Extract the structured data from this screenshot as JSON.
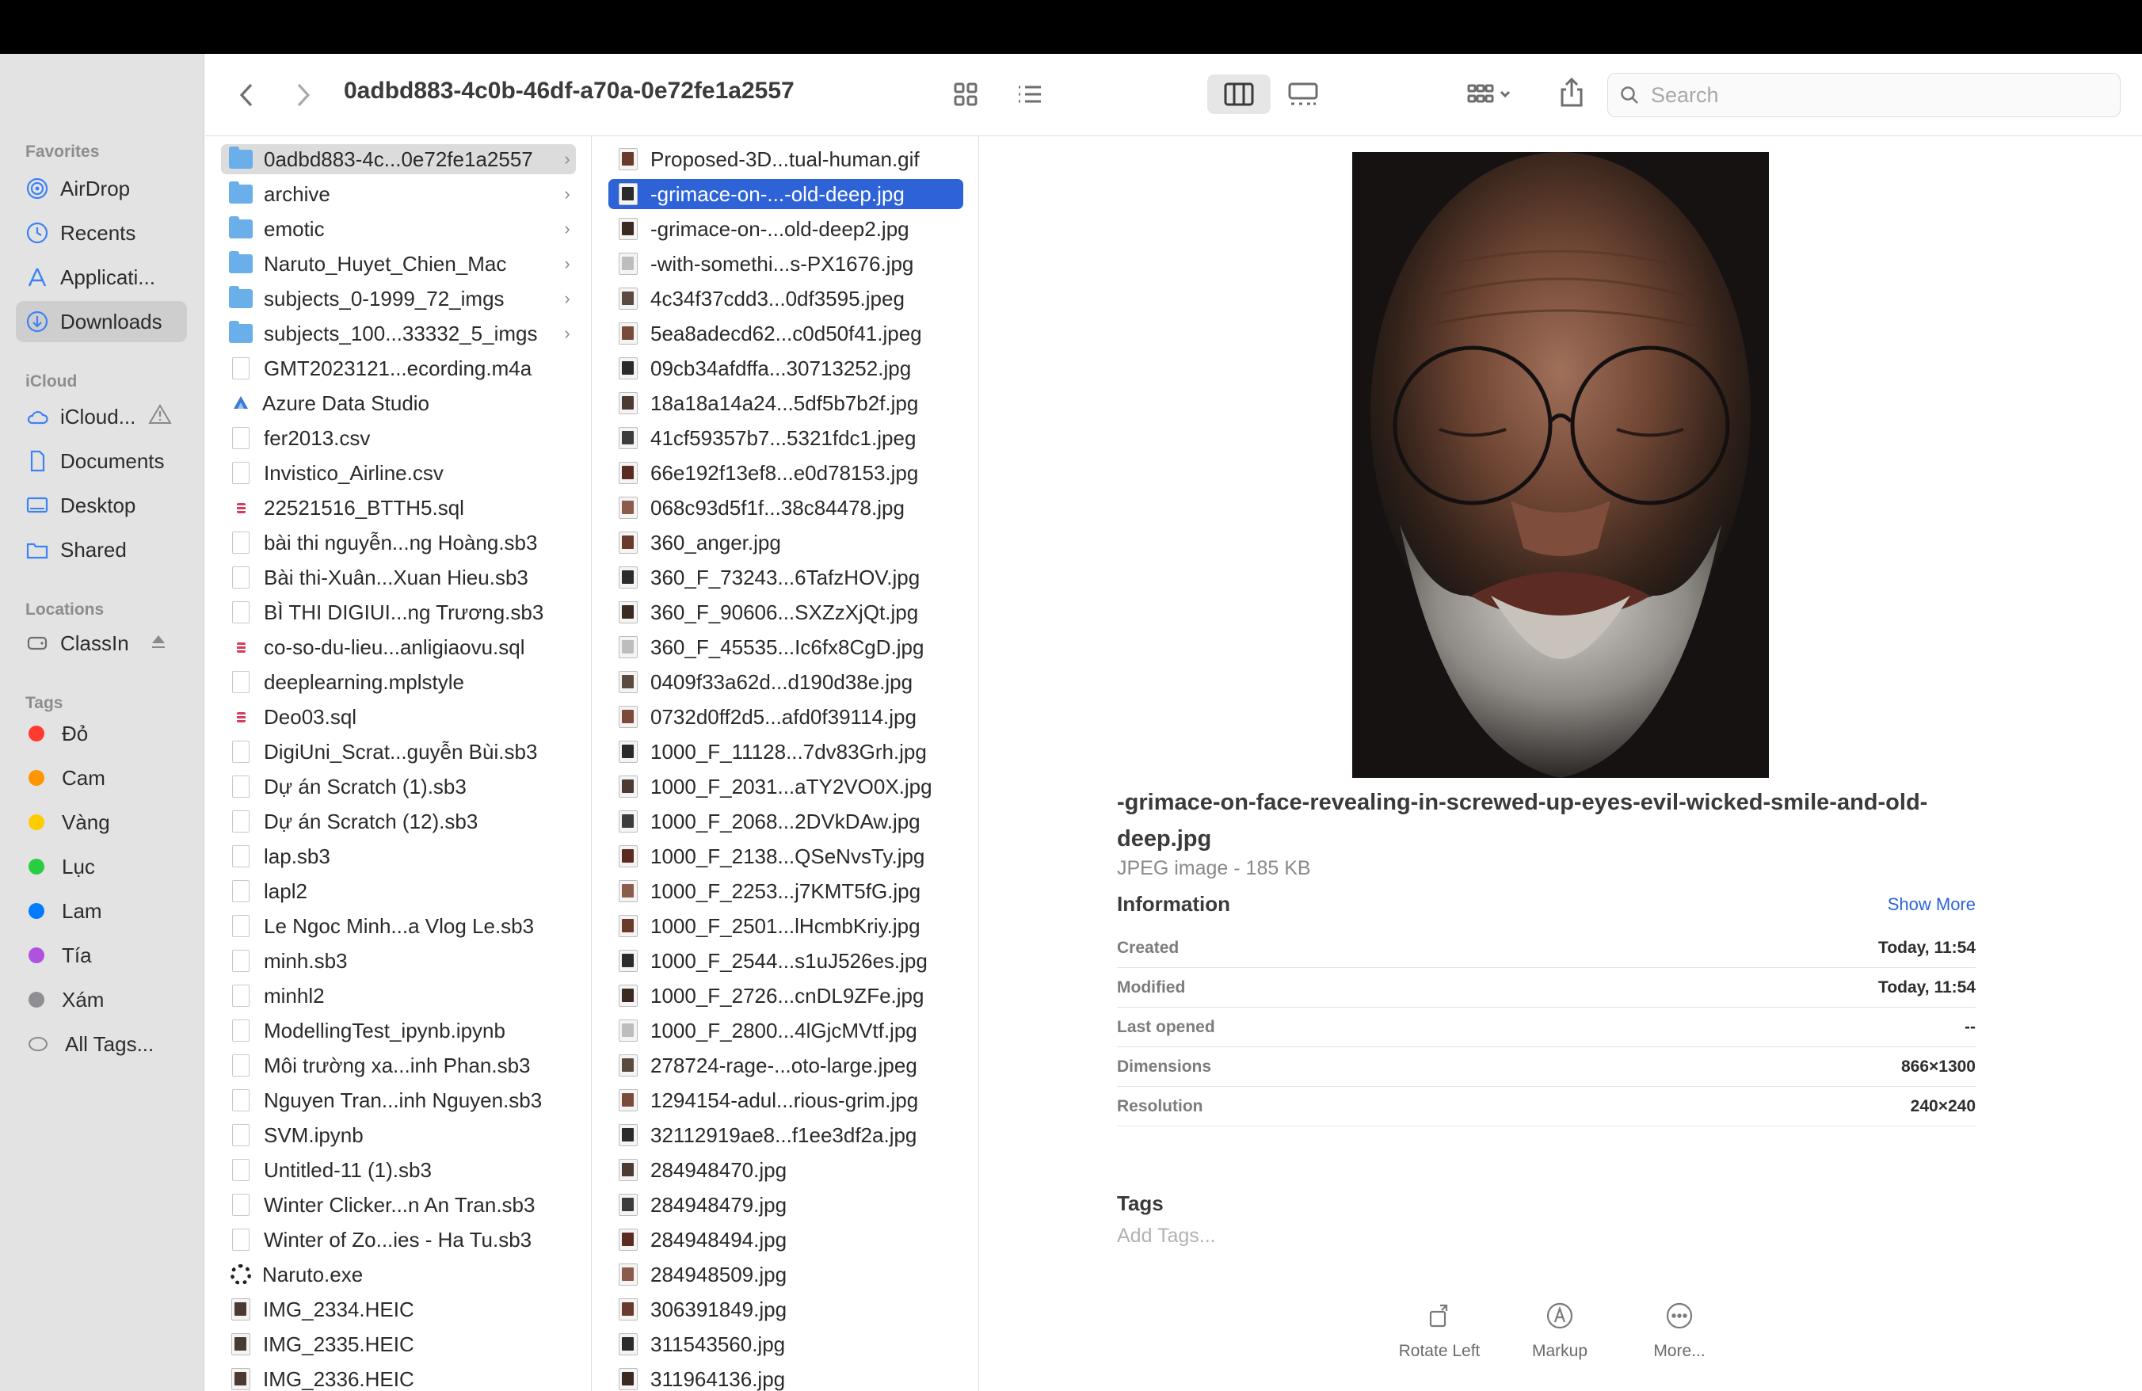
{
  "window": {
    "path_title": "0adbd883-4c0b-46df-a70a-0e72fe1a2557"
  },
  "toolbar": {
    "search_placeholder": "Search"
  },
  "sidebar": {
    "sections": {
      "favorites": "Favorites",
      "icloud": "iCloud",
      "locations": "Locations",
      "tags": "Tags"
    },
    "favorites": [
      {
        "label": "AirDrop",
        "icon": "airdrop-icon"
      },
      {
        "label": "Recents",
        "icon": "clock-icon"
      },
      {
        "label": "Applicati...",
        "icon": "applications-icon"
      },
      {
        "label": "Downloads",
        "icon": "download-icon"
      }
    ],
    "icloud": [
      {
        "label": "iCloud...",
        "icon": "cloud-icon"
      },
      {
        "label": "Documents",
        "icon": "document-icon"
      },
      {
        "label": "Desktop",
        "icon": "desktop-icon"
      },
      {
        "label": "Shared",
        "icon": "shared-folder-icon"
      }
    ],
    "locations": [
      {
        "label": "ClassIn",
        "icon": "disk-icon"
      }
    ],
    "tags": [
      {
        "label": "Đỏ",
        "color": "#ff3b30"
      },
      {
        "label": "Cam",
        "color": "#ff9500"
      },
      {
        "label": "Vàng",
        "color": "#ffcc00"
      },
      {
        "label": "Lục",
        "color": "#28cd41"
      },
      {
        "label": "Lam",
        "color": "#007aff"
      },
      {
        "label": "Tía",
        "color": "#af52de"
      },
      {
        "label": "Xám",
        "color": "#8e8e93"
      },
      {
        "label": "All Tags...",
        "color": ""
      }
    ]
  },
  "column1": [
    {
      "label": "0adbd883-4c...0e72fe1a2557",
      "type": "folder"
    },
    {
      "label": "archive",
      "type": "folder"
    },
    {
      "label": "emotic",
      "type": "folder"
    },
    {
      "label": "Naruto_Huyet_Chien_Mac",
      "type": "folder"
    },
    {
      "label": "subjects_0-1999_72_imgs",
      "type": "folder"
    },
    {
      "label": "subjects_100...33332_5_imgs",
      "type": "folder"
    },
    {
      "label": "GMT2023121...ecording.m4a",
      "type": "doc"
    },
    {
      "label": "Azure Data Studio",
      "type": "app"
    },
    {
      "label": "fer2013.csv",
      "type": "doc"
    },
    {
      "label": "Invistico_Airline.csv",
      "type": "doc"
    },
    {
      "label": "22521516_BTTH5.sql",
      "type": "sql"
    },
    {
      "label": "bài thi nguyễn...ng Hoàng.sb3",
      "type": "doc"
    },
    {
      "label": "Bài thi-Xuân...Xuan Hieu.sb3",
      "type": "doc"
    },
    {
      "label": "BÌ THI DIGIUI...ng Trương.sb3",
      "type": "doc"
    },
    {
      "label": "co-so-du-lieu...anligiaovu.sql",
      "type": "sql"
    },
    {
      "label": "deeplearning.mplstyle",
      "type": "doc"
    },
    {
      "label": "Deo03.sql",
      "type": "sql"
    },
    {
      "label": "DigiUni_Scrat...guyễn Bùi.sb3",
      "type": "doc"
    },
    {
      "label": "Dự án Scratch (1).sb3",
      "type": "doc"
    },
    {
      "label": "Dự án Scratch (12).sb3",
      "type": "doc"
    },
    {
      "label": "lap.sb3",
      "type": "doc"
    },
    {
      "label": "lapl2",
      "type": "doc"
    },
    {
      "label": "Le Ngoc Minh...a Vlog Le.sb3",
      "type": "doc"
    },
    {
      "label": "minh.sb3",
      "type": "doc"
    },
    {
      "label": "minhl2",
      "type": "doc"
    },
    {
      "label": "ModellingTest_ipynb.ipynb",
      "type": "doc"
    },
    {
      "label": "Môi trường xa...inh Phan.sb3",
      "type": "doc"
    },
    {
      "label": "Nguyen Tran...inh Nguyen.sb3",
      "type": "doc"
    },
    {
      "label": "SVM.ipynb",
      "type": "doc"
    },
    {
      "label": "Untitled-11 (1).sb3",
      "type": "doc"
    },
    {
      "label": "Winter Clicker...n An Tran.sb3",
      "type": "doc"
    },
    {
      "label": "Winter of Zo...ies - Ha Tu.sb3",
      "type": "doc"
    },
    {
      "label": "Naruto.exe",
      "type": "gear"
    },
    {
      "label": "IMG_2334.HEIC",
      "type": "img"
    },
    {
      "label": "IMG_2335.HEIC",
      "type": "img"
    },
    {
      "label": "IMG_2336.HEIC",
      "type": "img"
    }
  ],
  "column2": [
    "Proposed-3D...tual-human.gif",
    "-grimace-on-...-old-deep.jpg",
    "-grimace-on-...old-deep2.jpg",
    "-with-somethi...s-PX1676.jpg",
    "4c34f37cdd3...0df3595.jpeg",
    "5ea8adecd62...c0d50f41.jpeg",
    "09cb34afdffa...30713252.jpg",
    "18a18a14a24...5df5b7b2f.jpg",
    "41cf59357b7...5321fdc1.jpeg",
    "66e192f13ef8...e0d78153.jpg",
    "068c93d5f1f...38c84478.jpg",
    "360_anger.jpg",
    "360_F_73243...6TafzHOV.jpg",
    "360_F_90606...SXZzXjQt.jpg",
    "360_F_45535...Ic6fx8CgD.jpg",
    "0409f33a62d...d190d38e.jpg",
    "0732d0ff2d5...afd0f39114.jpg",
    "1000_F_11128...7dv83Grh.jpg",
    "1000_F_2031...aTY2VO0X.jpg",
    "1000_F_2068...2DVkDAw.jpg",
    "1000_F_2138...QSeNvsTy.jpg",
    "1000_F_2253...j7KMT5fG.jpg",
    "1000_F_2501...lHcmbKriy.jpg",
    "1000_F_2544...s1uJ526es.jpg",
    "1000_F_2726...cnDL9ZFe.jpg",
    "1000_F_2800...4lGjcMVtf.jpg",
    "278724-rage-...oto-large.jpeg",
    "1294154-adul...rious-grim.jpg",
    "32112919ae8...f1ee3df2a.jpg",
    "284948470.jpg",
    "284948479.jpg",
    "284948494.jpg",
    "284948509.jpg",
    "306391849.jpg",
    "311543560.jpg",
    "311964136.jpg"
  ],
  "preview": {
    "file_name": "-grimace-on-face-revealing-in-screwed-up-eyes-evil-wicked-smile-and-old-deep.jpg",
    "file_kind": "JPEG image - 185 KB",
    "information_label": "Information",
    "show_more": "Show More",
    "info": [
      {
        "key": "Created",
        "value": "Today, 11:54"
      },
      {
        "key": "Modified",
        "value": "Today, 11:54"
      },
      {
        "key": "Last opened",
        "value": "--"
      },
      {
        "key": "Dimensions",
        "value": "866×1300"
      },
      {
        "key": "Resolution",
        "value": "240×240"
      }
    ],
    "tags_label": "Tags",
    "tags_placeholder": "Add Tags...",
    "actions": {
      "rotate": "Rotate Left",
      "markup": "Markup",
      "more": "More..."
    }
  }
}
